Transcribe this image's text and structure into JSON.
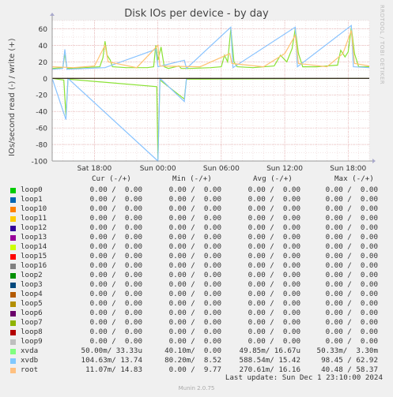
{
  "header": {
    "title": "Disk IOs per device - by day",
    "ylabel": "IOs/second read (-) / write (+)",
    "side_text": "RRDTOOL / TOBI OETIKER"
  },
  "chart_data": {
    "type": "line",
    "title": "Disk IOs per device - by day",
    "ylabel": "IOs/second read (-) / write (+)",
    "ylim": [
      -100,
      70
    ],
    "yticks": [
      -100,
      -80,
      -60,
      -40,
      -20,
      0,
      20,
      40,
      60
    ],
    "xlim": [
      0,
      30
    ],
    "x_unit": "hours since start",
    "xtick_labels": [
      "Sat 18:00",
      "Sun 00:00",
      "Sun 06:00",
      "Sun 12:00",
      "Sun 18:00"
    ],
    "xticks": [
      4,
      10,
      16,
      22,
      28
    ],
    "grid": true,
    "series": [
      {
        "name": "xvda",
        "color": "#8AE234",
        "write": [
          [
            0,
            12
          ],
          [
            1,
            13
          ],
          [
            1.2,
            30
          ],
          [
            1.4,
            12
          ],
          [
            3,
            13
          ],
          [
            4.5,
            14
          ],
          [
            4.8,
            25
          ],
          [
            5,
            45
          ],
          [
            5.2,
            28
          ],
          [
            5.5,
            22
          ],
          [
            5.7,
            14
          ],
          [
            7,
            13
          ],
          [
            9,
            13
          ],
          [
            9.6,
            14
          ],
          [
            9.8,
            40
          ],
          [
            10,
            22
          ],
          [
            10.3,
            38
          ],
          [
            10.6,
            14
          ],
          [
            11,
            12
          ],
          [
            12,
            15
          ],
          [
            12.2,
            12
          ],
          [
            13,
            12
          ],
          [
            15,
            13
          ],
          [
            16,
            14
          ],
          [
            16.3,
            28
          ],
          [
            16.6,
            20
          ],
          [
            16.9,
            60
          ],
          [
            17.2,
            20
          ],
          [
            17.5,
            14
          ],
          [
            19,
            13
          ],
          [
            21,
            15
          ],
          [
            21.6,
            28
          ],
          [
            22.2,
            20
          ],
          [
            22.7,
            36
          ],
          [
            23,
            60
          ],
          [
            23.3,
            30
          ],
          [
            23.7,
            14
          ],
          [
            25,
            14
          ],
          [
            27,
            16
          ],
          [
            27.3,
            34
          ],
          [
            27.7,
            26
          ],
          [
            28,
            32
          ],
          [
            28.3,
            62
          ],
          [
            28.6,
            30
          ],
          [
            29,
            14
          ],
          [
            30,
            14
          ]
        ],
        "read": [
          [
            0,
            0
          ],
          [
            1.1,
            -2
          ],
          [
            1.3,
            -45
          ],
          [
            1.5,
            -1
          ],
          [
            9.9,
            -10
          ],
          [
            10,
            -98
          ],
          [
            10.2,
            -2
          ],
          [
            12.5,
            -25
          ],
          [
            12.7,
            -1
          ],
          [
            30,
            0
          ]
        ]
      },
      {
        "name": "xvdb",
        "color": "#88C3FF",
        "write": [
          [
            0,
            11
          ],
          [
            1,
            12
          ],
          [
            1.2,
            35
          ],
          [
            1.4,
            11
          ],
          [
            5,
            13
          ],
          [
            9.8,
            35
          ],
          [
            10,
            14
          ],
          [
            12.5,
            22
          ],
          [
            12.7,
            12
          ],
          [
            16.9,
            62
          ],
          [
            17.1,
            13
          ],
          [
            23,
            62
          ],
          [
            23.2,
            14
          ],
          [
            28.3,
            64
          ],
          [
            28.5,
            14
          ],
          [
            30,
            13
          ]
        ],
        "read": [
          [
            0,
            0
          ],
          [
            1.3,
            -50
          ],
          [
            1.5,
            0
          ],
          [
            10,
            -100
          ],
          [
            10.2,
            0
          ],
          [
            12.5,
            -28
          ],
          [
            12.7,
            0
          ],
          [
            30,
            0
          ]
        ]
      },
      {
        "name": "root",
        "color": "#FFC374",
        "write": [
          [
            0,
            14
          ],
          [
            2,
            13
          ],
          [
            4,
            15
          ],
          [
            5,
            40
          ],
          [
            5.3,
            20
          ],
          [
            8,
            13
          ],
          [
            10,
            40
          ],
          [
            10.2,
            15
          ],
          [
            14,
            14
          ],
          [
            16.8,
            30
          ],
          [
            17,
            18
          ],
          [
            20,
            14
          ],
          [
            22,
            30
          ],
          [
            23,
            52
          ],
          [
            23.3,
            18
          ],
          [
            26,
            14
          ],
          [
            27.5,
            30
          ],
          [
            28.3,
            58
          ],
          [
            28.6,
            18
          ],
          [
            30,
            15
          ]
        ],
        "read": [
          [
            0,
            0
          ],
          [
            30,
            0
          ]
        ]
      }
    ]
  },
  "legend": {
    "headers": {
      "cur": "Cur (-/+)",
      "min": "Min (-/+)",
      "avg": "Avg (-/+)",
      "max": "Max (-/+)"
    },
    "rows": [
      {
        "name": "loop0",
        "color": "#00CC00",
        "cur": "0.00 /  0.00",
        "min": "0.00 /  0.00",
        "avg": "0.00 /  0.00",
        "max": "0.00 /  0.00"
      },
      {
        "name": "loop1",
        "color": "#0066B3",
        "cur": "0.00 /  0.00",
        "min": "0.00 /  0.00",
        "avg": "0.00 /  0.00",
        "max": "0.00 /  0.00"
      },
      {
        "name": "loop10",
        "color": "#FF8000",
        "cur": "0.00 /  0.00",
        "min": "0.00 /  0.00",
        "avg": "0.00 /  0.00",
        "max": "0.00 /  0.00"
      },
      {
        "name": "loop11",
        "color": "#FFCC00",
        "cur": "0.00 /  0.00",
        "min": "0.00 /  0.00",
        "avg": "0.00 /  0.00",
        "max": "0.00 /  0.00"
      },
      {
        "name": "loop12",
        "color": "#330099",
        "cur": "0.00 /  0.00",
        "min": "0.00 /  0.00",
        "avg": "0.00 /  0.00",
        "max": "0.00 /  0.00"
      },
      {
        "name": "loop13",
        "color": "#990099",
        "cur": "0.00 /  0.00",
        "min": "0.00 /  0.00",
        "avg": "0.00 /  0.00",
        "max": "0.00 /  0.00"
      },
      {
        "name": "loop14",
        "color": "#CCFF00",
        "cur": "0.00 /  0.00",
        "min": "0.00 /  0.00",
        "avg": "0.00 /  0.00",
        "max": "0.00 /  0.00"
      },
      {
        "name": "loop15",
        "color": "#FF0000",
        "cur": "0.00 /  0.00",
        "min": "0.00 /  0.00",
        "avg": "0.00 /  0.00",
        "max": "0.00 /  0.00"
      },
      {
        "name": "loop16",
        "color": "#808080",
        "cur": "0.00 /  0.00",
        "min": "0.00 /  0.00",
        "avg": "0.00 /  0.00",
        "max": "0.00 /  0.00"
      },
      {
        "name": "loop2",
        "color": "#008F00",
        "cur": "0.00 /  0.00",
        "min": "0.00 /  0.00",
        "avg": "0.00 /  0.00",
        "max": "0.00 /  0.00"
      },
      {
        "name": "loop3",
        "color": "#00487D",
        "cur": "0.00 /  0.00",
        "min": "0.00 /  0.00",
        "avg": "0.00 /  0.00",
        "max": "0.00 /  0.00"
      },
      {
        "name": "loop4",
        "color": "#B35A00",
        "cur": "0.00 /  0.00",
        "min": "0.00 /  0.00",
        "avg": "0.00 /  0.00",
        "max": "0.00 /  0.00"
      },
      {
        "name": "loop5",
        "color": "#B38F00",
        "cur": "0.00 /  0.00",
        "min": "0.00 /  0.00",
        "avg": "0.00 /  0.00",
        "max": "0.00 /  0.00"
      },
      {
        "name": "loop6",
        "color": "#6B006B",
        "cur": "0.00 /  0.00",
        "min": "0.00 /  0.00",
        "avg": "0.00 /  0.00",
        "max": "0.00 /  0.00"
      },
      {
        "name": "loop7",
        "color": "#8FB300",
        "cur": "0.00 /  0.00",
        "min": "0.00 /  0.00",
        "avg": "0.00 /  0.00",
        "max": "0.00 /  0.00"
      },
      {
        "name": "loop8",
        "color": "#B30000",
        "cur": "0.00 /  0.00",
        "min": "0.00 /  0.00",
        "avg": "0.00 /  0.00",
        "max": "0.00 /  0.00"
      },
      {
        "name": "loop9",
        "color": "#BEBEBE",
        "cur": "0.00 /  0.00",
        "min": "0.00 /  0.00",
        "avg": "0.00 /  0.00",
        "max": "0.00 /  0.00"
      },
      {
        "name": "xvda",
        "color": "#80FF80",
        "cur": "50.00m/ 33.33u",
        "min": "40.10m/  0.00",
        "avg": "49.85m/ 16.67u",
        "max": "50.33m/  3.30m"
      },
      {
        "name": "xvdb",
        "color": "#80C9FF",
        "cur": "104.63m/ 13.74",
        "min": "80.20m/  8.52",
        "avg": "588.54m/ 15.42",
        "max": "98.45 / 62.92"
      },
      {
        "name": "root",
        "color": "#FFC080",
        "cur": "11.07m/ 14.83",
        "min": "0.00 /  9.77",
        "avg": "270.61m/ 16.16",
        "max": "40.48 / 58.37"
      }
    ]
  },
  "last_update": "Last update: Sun Dec  1 23:10:00 2024",
  "footer": "Munin 2.0.75"
}
